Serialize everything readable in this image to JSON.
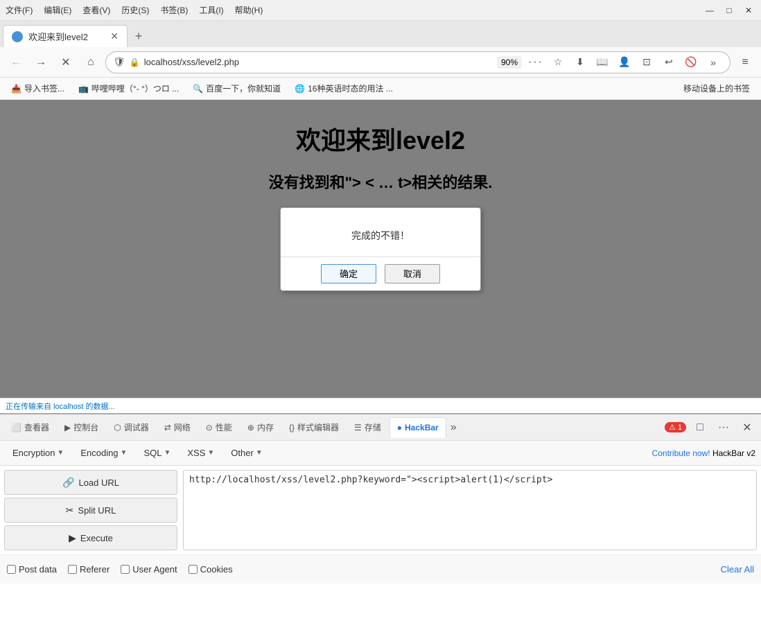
{
  "titlebar": {
    "menu_items": [
      "文件(F)",
      "编辑(E)",
      "查看(V)",
      "历史(S)",
      "书签(B)",
      "工具(I)",
      "帮助(H)"
    ],
    "min_label": "—",
    "max_label": "□",
    "close_label": "✕"
  },
  "tab": {
    "title": "欢迎来到level2",
    "close_label": "✕",
    "new_label": "+"
  },
  "addressbar": {
    "back_icon": "←",
    "forward_icon": "→",
    "close_icon": "✕",
    "home_icon": "⌂",
    "shield_icon": "🛡",
    "lock_icon": "🔒",
    "url": "localhost/xss/level2.php",
    "zoom": "90%",
    "more_icon": "···",
    "star_icon": "☆",
    "download_icon": "⬇",
    "reader_icon": "📖",
    "sync_icon": "👤",
    "crop_icon": "⊡",
    "undo_icon": "↩",
    "blocked_icon": "🚫",
    "extend_icon": "»",
    "menu_icon": "≡"
  },
  "bookmarks": {
    "items": [
      {
        "label": "导入书签...",
        "icon": "📥"
      },
      {
        "label": "哔哩哔哩（°- °）つロ ...",
        "icon": "📺"
      },
      {
        "label": "百度一下，你就知道",
        "icon": "🔍"
      },
      {
        "label": "16种英语时态的用法 ...",
        "icon": "🌐"
      }
    ],
    "mobile_label": "移动设备上的书签"
  },
  "page": {
    "title": "欢迎来到level2",
    "subtitle_prefix": "没有找到和\"> <",
    "subtitle_suffix": "t>相关的结果."
  },
  "dialog": {
    "message": "完成的不错！",
    "confirm_label": "确定",
    "cancel_label": "取消"
  },
  "statusbar": {
    "text": "正在传输来自 localhost 的数据..."
  },
  "devtools": {
    "tabs": [
      {
        "label": "查看器",
        "icon": "⬜",
        "active": false
      },
      {
        "label": "控制台",
        "icon": "▶",
        "active": false
      },
      {
        "label": "调试器",
        "icon": "⬡",
        "active": false
      },
      {
        "label": "网络",
        "icon": "⇄",
        "active": false
      },
      {
        "label": "性能",
        "icon": "⊙",
        "active": false
      },
      {
        "label": "内存",
        "icon": "⊕",
        "active": false
      },
      {
        "label": "样式编辑器",
        "icon": "{}",
        "active": false
      },
      {
        "label": "存储",
        "icon": "☰",
        "active": false
      },
      {
        "label": "HackBar",
        "icon": "●",
        "active": true
      }
    ],
    "more_label": "»",
    "error_count": "1",
    "dock_icon": "□",
    "more_options_icon": "···",
    "close_icon": "✕"
  },
  "hackbar": {
    "menus": [
      {
        "label": "Encryption"
      },
      {
        "label": "Encoding"
      },
      {
        "label": "SQL"
      },
      {
        "label": "XSS"
      },
      {
        "label": "Other"
      }
    ],
    "contribute_text": "Contribute now!",
    "version_text": "HackBar v2",
    "load_url_label": "Load URL",
    "split_url_label": "Split URL",
    "execute_label": "Execute",
    "url_value": "http://localhost/xss/level2.php?keyword=\"><script>alert(1)</script>",
    "checkboxes": [
      {
        "label": "Post data",
        "checked": false
      },
      {
        "label": "Referer",
        "checked": false
      },
      {
        "label": "User Agent",
        "checked": false
      },
      {
        "label": "Cookies",
        "checked": false
      }
    ],
    "clear_all_label": "Clear All"
  }
}
